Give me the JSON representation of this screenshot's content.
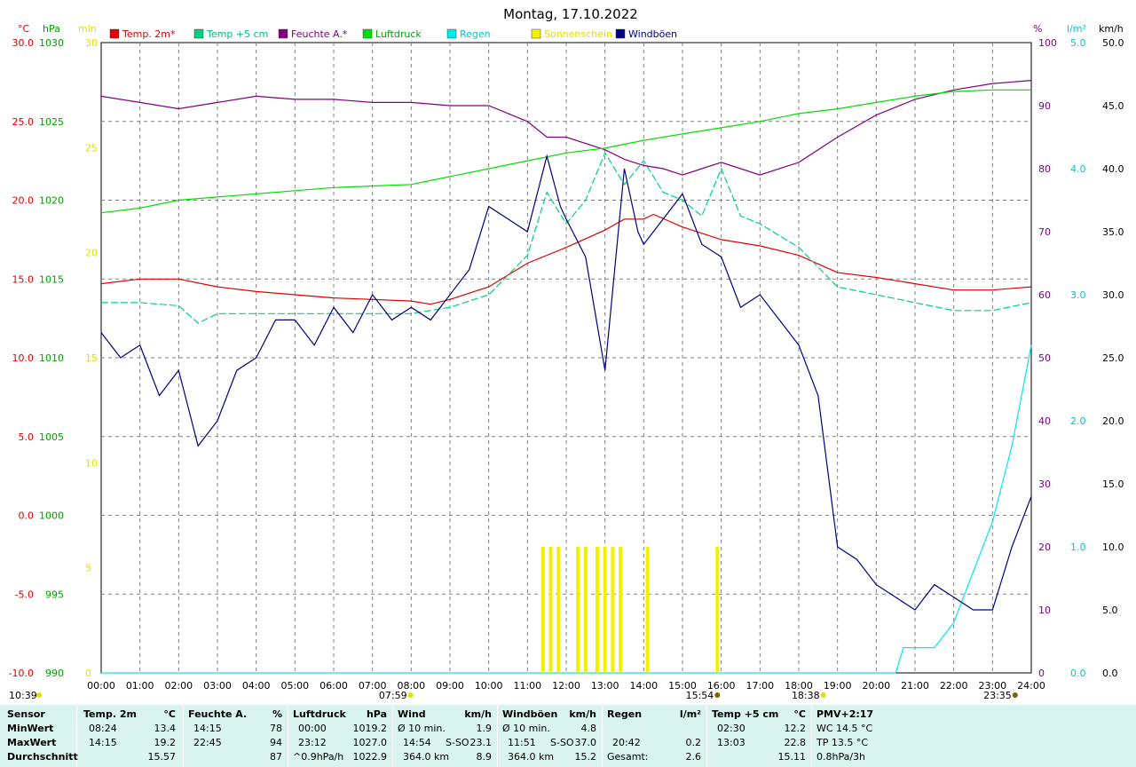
{
  "title": "Montag, 17.10.2022",
  "colors": {
    "temp2m": "#e00000",
    "temp5cm": "#00d080",
    "humidity": "#800080",
    "pressure": "#00e000",
    "rain": "#00e8e8",
    "sunshine": "#f0f000",
    "gusts": "#000080",
    "grid": "#808080"
  },
  "legend": [
    "Temp. 2m*",
    "Temp +5 cm",
    "Feuchte A.*",
    "Luftdruck",
    "Regen",
    "Sonnenschein",
    "Windböen"
  ],
  "axes": {
    "temp_unit": "°C",
    "pressure_unit": "hPa",
    "sun_unit": "min",
    "hum_unit": "%",
    "rain_unit": "l/m²",
    "wind_unit": "km/h",
    "temp_ticks": [
      "30.0",
      "25.0",
      "20.0",
      "15.0",
      "10.0",
      "5.0",
      "0.0",
      "-5.0",
      "-10.0"
    ],
    "pressure_ticks": [
      "1030",
      "1025",
      "1020",
      "1015",
      "1010",
      "1005",
      "1000",
      "995",
      "990"
    ],
    "sun_ticks": [
      "30",
      "25",
      "20",
      "15",
      "10",
      "5",
      "0"
    ],
    "hum_ticks": [
      "100",
      "90",
      "80",
      "70",
      "60",
      "50",
      "40",
      "30",
      "20",
      "10",
      "0"
    ],
    "rain_ticks": [
      "5.0",
      "4.0",
      "3.0",
      "2.0",
      "1.0",
      "0.0"
    ],
    "wind_ticks": [
      "50.0",
      "45.0",
      "40.0",
      "35.0",
      "30.0",
      "25.0",
      "20.0",
      "15.0",
      "10.0",
      "5.0",
      "0.0"
    ],
    "time_ticks": [
      "00:00",
      "01:00",
      "02:00",
      "03:00",
      "04:00",
      "05:00",
      "06:00",
      "07:00",
      "08:00",
      "09:00",
      "10:00",
      "11:00",
      "12:00",
      "13:00",
      "14:00",
      "15:00",
      "16:00",
      "17:00",
      "18:00",
      "19:00",
      "20:00",
      "21:00",
      "22:00",
      "23:00",
      "24:00"
    ],
    "sunrise": "07:59",
    "sunset": "18:38",
    "moonrise": "15:54",
    "moonset": "10:39",
    "moon2": "23:35"
  },
  "chart_data": {
    "type": "line",
    "title": "Montag, 17.10.2022",
    "x_unit": "hours",
    "series": [
      {
        "name": "Temp. 2m*",
        "axis": "temp",
        "x": [
          0,
          1,
          2,
          3,
          4,
          5,
          6,
          7,
          8,
          8.5,
          9,
          10,
          11,
          12,
          13,
          13.5,
          14,
          14.25,
          15,
          16,
          17,
          18,
          19,
          20,
          21,
          22,
          23,
          24
        ],
        "values": [
          14.7,
          15.0,
          15.0,
          14.5,
          14.2,
          14.0,
          13.8,
          13.7,
          13.6,
          13.4,
          13.7,
          14.5,
          16.0,
          17.0,
          18.1,
          18.8,
          18.8,
          19.1,
          18.3,
          17.5,
          17.1,
          16.5,
          15.4,
          15.1,
          14.7,
          14.3,
          14.3,
          14.5
        ]
      },
      {
        "name": "Temp +5 cm",
        "axis": "temp",
        "x": [
          0,
          1,
          2,
          2.5,
          3,
          4,
          5,
          6,
          7,
          8,
          9,
          10,
          11,
          11.5,
          12,
          12.5,
          13,
          13.5,
          14,
          14.5,
          15,
          15.5,
          16,
          16.5,
          17,
          18,
          19,
          20,
          21,
          22,
          23,
          24
        ],
        "values": [
          13.5,
          13.5,
          13.3,
          12.2,
          12.8,
          12.8,
          12.8,
          12.8,
          12.8,
          12.8,
          13.2,
          14.0,
          16.5,
          20.5,
          18.5,
          20.0,
          23.0,
          21.0,
          22.5,
          20.5,
          20.0,
          19.0,
          22.0,
          19.0,
          18.5,
          17.0,
          14.5,
          14.0,
          13.5,
          13.0,
          13.0,
          13.5
        ]
      },
      {
        "name": "Feuchte A.*",
        "axis": "hum",
        "x": [
          0,
          1,
          2,
          3,
          4,
          5,
          6,
          7,
          8,
          9,
          10,
          11,
          11.5,
          12,
          13,
          13.5,
          14,
          14.5,
          15,
          15.5,
          16,
          16.5,
          17,
          18,
          19,
          20,
          21,
          22,
          23,
          24
        ],
        "values": [
          91.5,
          90.5,
          89.5,
          90.5,
          91.5,
          91,
          91,
          90.5,
          90.5,
          90,
          90,
          87.5,
          85,
          85,
          83,
          81.5,
          80.5,
          80,
          79,
          80,
          81,
          80,
          79,
          81,
          85,
          88.5,
          91,
          92.5,
          93.5,
          94
        ]
      },
      {
        "name": "Luftdruck",
        "axis": "pressure",
        "x": [
          0,
          1,
          2,
          3,
          4,
          5,
          6,
          7,
          8,
          9,
          10,
          11,
          12,
          13,
          14,
          15,
          16,
          17,
          18,
          19,
          20,
          21,
          22,
          23,
          24
        ],
        "values": [
          1019.2,
          1019.5,
          1020.0,
          1020.2,
          1020.4,
          1020.6,
          1020.8,
          1020.9,
          1021.0,
          1021.5,
          1022.0,
          1022.5,
          1023.0,
          1023.3,
          1023.8,
          1024.2,
          1024.6,
          1025.0,
          1025.5,
          1025.8,
          1026.2,
          1026.6,
          1026.9,
          1027.0,
          1027.0
        ]
      },
      {
        "name": "Regen",
        "axis": "rain",
        "x": [
          0,
          20.5,
          20.7,
          21,
          21.5,
          22,
          22.5,
          23,
          23.5,
          24
        ],
        "values": [
          0,
          0,
          0.2,
          0.2,
          0.2,
          0.4,
          0.8,
          1.2,
          1.8,
          2.6
        ]
      },
      {
        "name": "Windböen",
        "axis": "wind",
        "x": [
          0,
          0.5,
          1,
          1.5,
          2,
          2.5,
          3,
          3.5,
          4,
          4.5,
          5,
          5.5,
          6,
          6.5,
          7,
          7.5,
          8,
          8.5,
          9,
          9.5,
          10,
          10.5,
          11,
          11.5,
          11.85,
          12,
          12.5,
          13,
          13.5,
          13.85,
          14,
          14.5,
          15,
          15.5,
          16,
          16.5,
          17,
          17.5,
          18,
          18.5,
          19,
          19.5,
          20,
          20.5,
          21,
          21.5,
          22,
          22.5,
          23,
          23.5,
          24
        ],
        "values": [
          27,
          25,
          26,
          22,
          24,
          18,
          20,
          24,
          25,
          28,
          28,
          26,
          29,
          27,
          30,
          28,
          29,
          28,
          30,
          32,
          37,
          36,
          35,
          41,
          37,
          36,
          33,
          24,
          40,
          35,
          34,
          36,
          38,
          34,
          33,
          29,
          30,
          28,
          26,
          22,
          10,
          9,
          7,
          6,
          5,
          7,
          6,
          5,
          5,
          10,
          14
        ]
      },
      {
        "name": "Sonnenschein",
        "axis": "sun",
        "type": "bar",
        "x": [
          11.4,
          11.6,
          11.8,
          12.3,
          12.5,
          12.8,
          13.0,
          13.2,
          13.4,
          14.1,
          15.9
        ],
        "values": [
          6,
          6,
          6,
          6,
          6,
          6,
          6,
          6,
          6,
          6,
          6
        ]
      }
    ]
  },
  "stats": {
    "headers": {
      "sensor": "Sensor",
      "temp": "Temp. 2m",
      "temp_unit": "°C",
      "hum": "Feuchte A.",
      "hum_unit": "%",
      "press": "Luftdruck",
      "press_unit": "hPa",
      "wind": "Wind",
      "wind_unit": "km/h",
      "gust": "Windböen",
      "gust_unit": "km/h",
      "rain": "Regen",
      "rain_unit": "l/m²",
      "t5": "Temp +5 cm",
      "t5_unit": "°C",
      "pmv": "PMV+2:17"
    },
    "rows": [
      {
        "label": "MinWert",
        "temp_t": "08:24",
        "temp_v": "13.4",
        "hum_t": "14:15",
        "hum_v": "78",
        "press_t": "00:00",
        "press_v": "1019.2",
        "wind_t": "Ø 10 min.",
        "wind_d": "",
        "wind_v": "1.9",
        "gust_t": "Ø 10 min.",
        "gust_d": "",
        "gust_v": "4.8",
        "rain_t": "",
        "rain_v": "",
        "t5_t": "02:30",
        "t5_v": "12.2",
        "pmv": "WC 14.5 °C"
      },
      {
        "label": "MaxWert",
        "temp_t": "14:15",
        "temp_v": "19.2",
        "hum_t": "22:45",
        "hum_v": "94",
        "press_t": "23:12",
        "press_v": "1027.0",
        "wind_t": "14:54",
        "wind_d": "S-SO",
        "wind_v": "23.1",
        "gust_t": "11:51",
        "gust_d": "S-SO",
        "gust_v": "37.0",
        "rain_t": "20:42",
        "rain_v": "0.2",
        "t5_t": "13:03",
        "t5_v": "22.8",
        "pmv": "TP 13.5 °C"
      },
      {
        "label": "Durchschnitt",
        "temp_t": "",
        "temp_v": "15.57",
        "hum_t": "",
        "hum_v": "87",
        "press_t": "^0.9hPa/h",
        "press_v": "1022.9",
        "wind_t": "364.0 km",
        "wind_d": "",
        "wind_v": "8.9",
        "gust_t": "364.0 km",
        "gust_d": "",
        "gust_v": "15.2",
        "rain_t": "Gesamt:",
        "rain_v": "2.6",
        "t5_t": "",
        "t5_v": "15.11",
        "pmv": "0.8hPa/3h"
      }
    ]
  }
}
